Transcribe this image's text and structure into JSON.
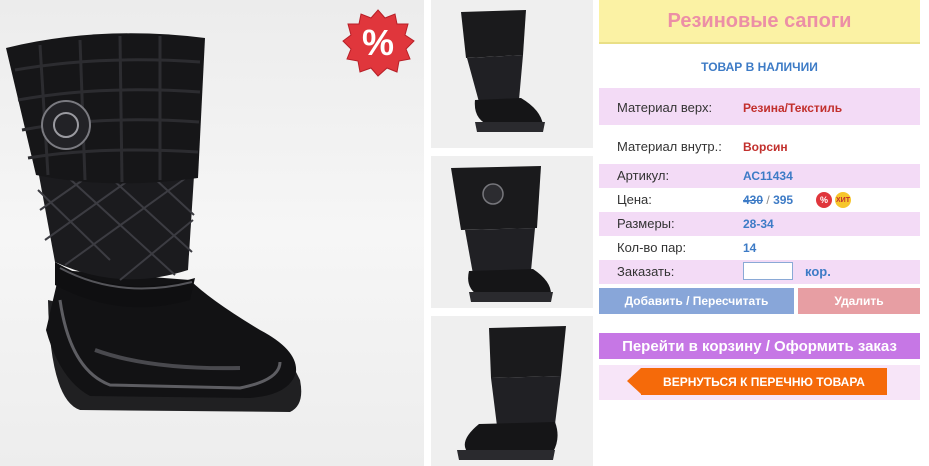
{
  "product": {
    "title": "Резиновые сапоги",
    "stock_status": "ТОВАР В НАЛИЧИИ"
  },
  "sale_badge": {
    "symbol": "%",
    "color": "#e0363c"
  },
  "specs": {
    "material_outer": {
      "label": "Материал верх:",
      "value": "Резина/Текстиль"
    },
    "material_inner": {
      "label": "Материал внутр.:",
      "value": "Ворсин"
    },
    "article": {
      "label": "Артикул:",
      "value": "АС11434"
    },
    "price": {
      "label": "Цена:",
      "old": "430",
      "separator": "/",
      "new": "395",
      "badge_sale": "%",
      "badge_hit": "ХИТ"
    },
    "sizes": {
      "label": "Размеры:",
      "value": "28-34"
    },
    "pairs": {
      "label": "Кол-во пар:",
      "value": "14"
    },
    "order": {
      "label": "Заказать:",
      "unit": "кор.",
      "input_value": ""
    }
  },
  "buttons": {
    "add": "Добавить / Пересчитать",
    "delete": "Удалить",
    "cart": "Перейти в корзину / Оформить заказ",
    "back": "ВЕРНУТЬСЯ К ПЕРЕЧНЮ ТОВАРА"
  },
  "colors": {
    "title_bg": "#fbf2a4",
    "title_text": "#ec8fa6",
    "row_highlight": "#f3dbf6",
    "add_button": "#88a6d9",
    "delete_button": "#e79ea3",
    "cart_button": "#c677e5",
    "back_button": "#f56a0a"
  }
}
